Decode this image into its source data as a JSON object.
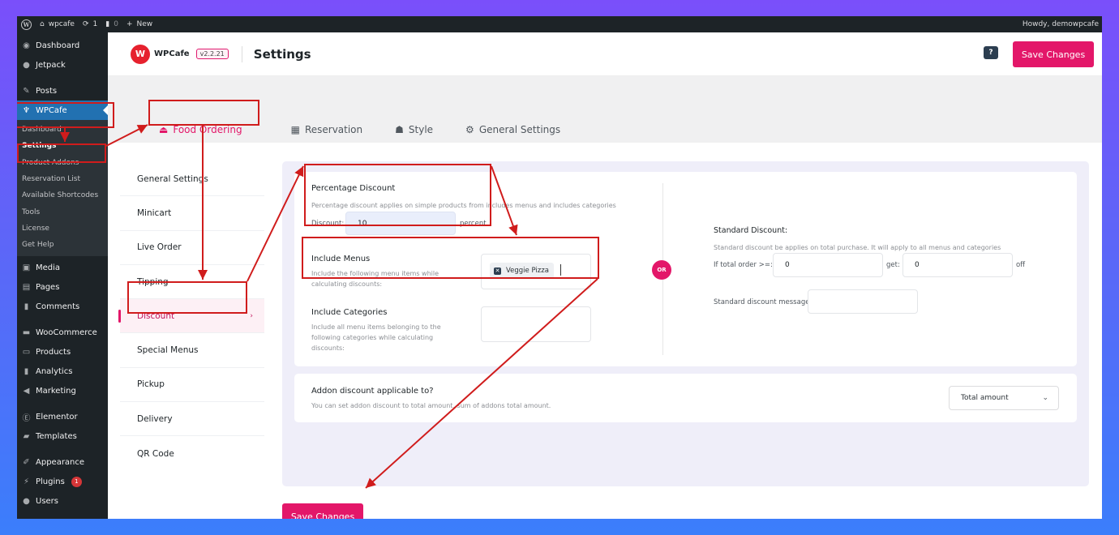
{
  "adminbar": {
    "site_name": "wpcafe",
    "updates_count": "1",
    "comments_count": "0",
    "new_label": "New",
    "greeting": "Howdy, demowpcafe"
  },
  "sidebar": {
    "items_top": [
      {
        "label": "Dashboard",
        "icon": "dashboard-icon"
      },
      {
        "label": "Jetpack",
        "icon": "jetpack-icon"
      }
    ],
    "posts": {
      "label": "Posts",
      "icon": "pin-icon"
    },
    "wpcafe": {
      "label": "WPCafe",
      "icon": "wpcafe-icon"
    },
    "submenu": [
      {
        "label": "Dashboard"
      },
      {
        "label": "Settings"
      },
      {
        "label": "Product Addons"
      },
      {
        "label": "Reservation List"
      },
      {
        "label": "Available Shortcodes"
      },
      {
        "label": "Tools"
      },
      {
        "label": "License"
      },
      {
        "label": "Get Help"
      }
    ],
    "items_mid": [
      {
        "label": "Media",
        "icon": "media-icon"
      },
      {
        "label": "Pages",
        "icon": "pages-icon"
      },
      {
        "label": "Comments",
        "icon": "comments-icon"
      }
    ],
    "items_woo": [
      {
        "label": "WooCommerce",
        "icon": "woocommerce-icon"
      },
      {
        "label": "Products",
        "icon": "products-icon"
      },
      {
        "label": "Analytics",
        "icon": "analytics-icon"
      },
      {
        "label": "Marketing",
        "icon": "marketing-icon"
      }
    ],
    "items_el": [
      {
        "label": "Elementor",
        "icon": "elementor-icon"
      },
      {
        "label": "Templates",
        "icon": "folder-icon"
      }
    ],
    "items_bottom": [
      {
        "label": "Appearance",
        "icon": "brush-icon"
      },
      {
        "label": "Plugins",
        "icon": "plugin-icon",
        "badge": "1"
      },
      {
        "label": "Users",
        "icon": "user-icon"
      }
    ]
  },
  "header": {
    "brand": "WPCafe",
    "version": "v2.2.21",
    "title": "Settings",
    "help": "?",
    "save_label": "Save Changes"
  },
  "tabs": [
    {
      "label": "Food Ordering",
      "icon": "food-bell-icon",
      "active": true
    },
    {
      "label": "Reservation",
      "icon": "calendar-icon"
    },
    {
      "label": "Style",
      "icon": "palette-icon"
    },
    {
      "label": "General Settings",
      "icon": "gear-icon"
    }
  ],
  "leftnav": [
    {
      "label": "General Settings"
    },
    {
      "label": "Minicart"
    },
    {
      "label": "Live Order"
    },
    {
      "label": "Tipping"
    },
    {
      "label": "Discount",
      "active": true
    },
    {
      "label": "Special Menus"
    },
    {
      "label": "Pickup"
    },
    {
      "label": "Delivery"
    },
    {
      "label": "QR Code"
    }
  ],
  "discount": {
    "percentage": {
      "title": "Percentage Discount",
      "desc": "Percentage discount applies on simple products from includes menus and includes categories",
      "field_label": "Discount:",
      "value": "10",
      "unit": "percent"
    },
    "include_menus": {
      "title": "Include Menus",
      "desc": "Include the following menu items while calculating discounts:",
      "chips": [
        "Veggie Pizza"
      ]
    },
    "include_categories": {
      "title": "Include Categories",
      "desc": "Include all menu items belonging to the following categories while calculating discounts:"
    },
    "or_label": "OR",
    "standard": {
      "title": "Standard Discount:",
      "desc": "Standard discount be applies on total purchase. It will apply to all menus and categories",
      "order_label": "If total order >=:",
      "order_value": "0",
      "get_label": "get:",
      "get_value": "0",
      "off_label": "off",
      "message_label": "Standard discount message",
      "message_value": ""
    },
    "addon": {
      "title": "Addon discount applicable to?",
      "desc": "You can set addon discount to total amount, sum of addons total amount.",
      "selected": "Total amount"
    }
  },
  "footer": {
    "save_label": "Save Changes"
  },
  "colors": {
    "accent": "#e31769",
    "wp_admin_dark": "#1d2327",
    "wp_admin_blue": "#2271b1",
    "annotation_red": "#d01c1c"
  }
}
